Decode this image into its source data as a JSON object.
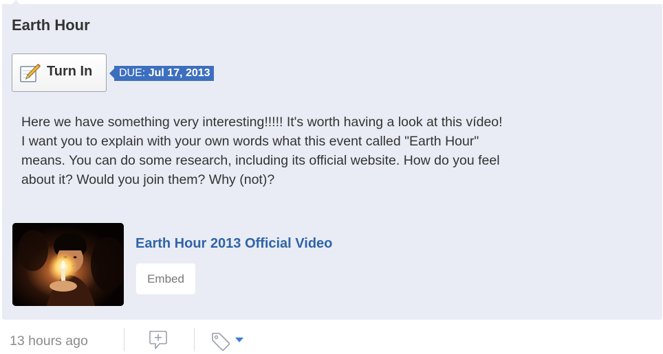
{
  "assignment": {
    "title": "Earth Hour",
    "turn_in_label": "Turn In",
    "due_prefix": "DUE:",
    "due_date": "Jul 17, 2013",
    "description_lines": [
      "Here we have something very interesting!!!!! It's worth having a look at this vídeo!",
      "I want you to explain with your own words what this event called \"Earth Hour\"",
      "means. You can do some research, including its official website. How do you feel",
      "about it? Would you join them? Why (not)?"
    ]
  },
  "attachment": {
    "video_title": "Earth Hour 2013 Official Video",
    "embed_label": "Embed",
    "thumbnail_icon": "video-thumbnail"
  },
  "footer": {
    "timestamp": "13 hours ago",
    "comment_icon": "comment-icon",
    "tag_icon": "tag-icon"
  },
  "colors": {
    "card_background": "#e9ecf4",
    "due_badge": "#3d6fbf",
    "link": "#2f64a8",
    "caret": "#3d7fd6"
  }
}
